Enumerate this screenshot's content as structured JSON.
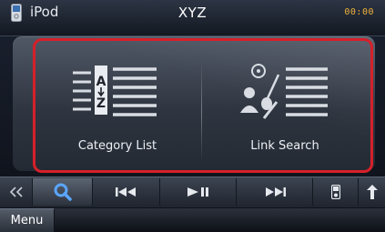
{
  "status": {
    "source_label": "iPod",
    "source_icon": "ipod-icon",
    "title": "XYZ",
    "clock": "00:00"
  },
  "options": [
    {
      "label": "Category List",
      "icon": "category-list-icon"
    },
    {
      "label": "Link Search",
      "icon": "link-search-icon"
    }
  ],
  "controls": [
    {
      "name": "collapse",
      "icon": "double-chevron-left-icon"
    },
    {
      "name": "search",
      "icon": "search-icon",
      "active": true
    },
    {
      "name": "previous",
      "icon": "skip-previous-icon"
    },
    {
      "name": "play-pause",
      "icon": "play-pause-icon"
    },
    {
      "name": "next",
      "icon": "skip-next-icon"
    },
    {
      "name": "device",
      "icon": "ipod-device-icon"
    },
    {
      "name": "arrow-up",
      "icon": "arrow-up-icon"
    }
  ],
  "menu": {
    "label": "Menu"
  },
  "colors": {
    "highlight_frame": "#d6202a",
    "search_icon": "#5aa6ff",
    "clock": "#f0b23a"
  }
}
